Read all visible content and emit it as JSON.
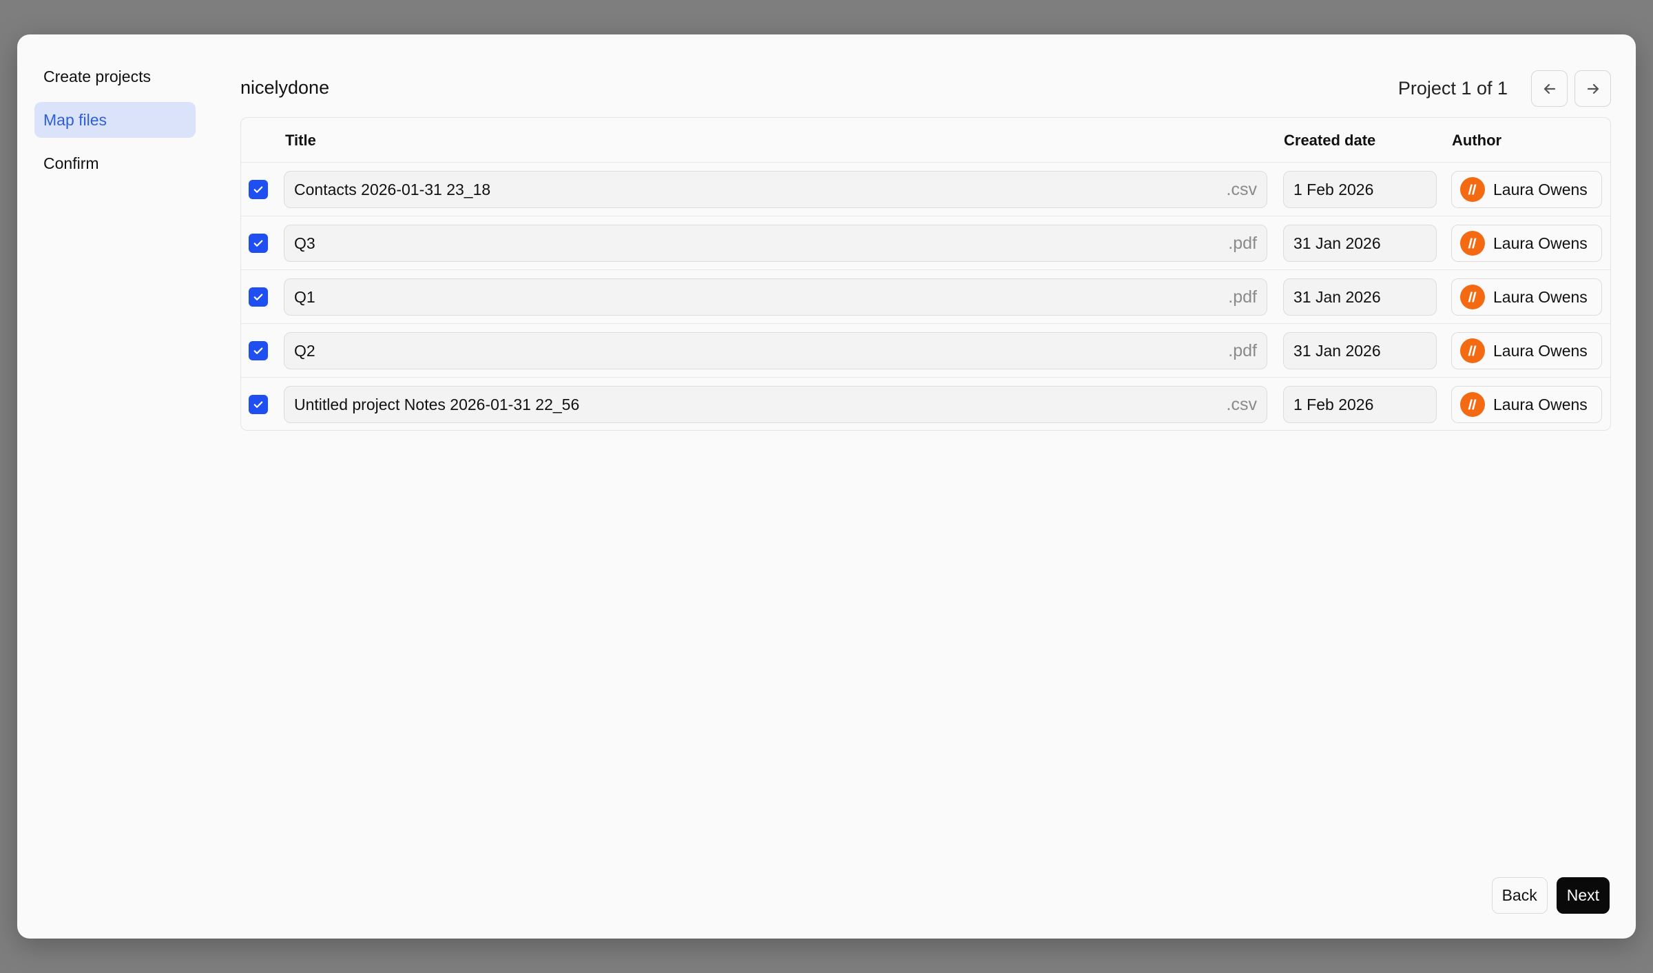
{
  "wizard": {
    "steps": [
      {
        "label": "Create projects"
      },
      {
        "label": "Map files"
      },
      {
        "label": "Confirm"
      }
    ],
    "active_step": 1
  },
  "header": {
    "project_name": "nicelydone",
    "pager_text": "Project 1 of 1",
    "prev_icon": "arrow-left-icon",
    "next_icon": "arrow-right-icon"
  },
  "table": {
    "columns": {
      "title": "Title",
      "created": "Created date",
      "author": "Author"
    },
    "rows": [
      {
        "checked": true,
        "title": "Contacts 2026-01-31 23_18",
        "ext": ".csv",
        "date": "1 Feb 2026",
        "author": "Laura Owens"
      },
      {
        "checked": true,
        "title": "Q3",
        "ext": ".pdf",
        "date": "31 Jan 2026",
        "author": "Laura Owens"
      },
      {
        "checked": true,
        "title": "Q1",
        "ext": ".pdf",
        "date": "31 Jan 2026",
        "author": "Laura Owens"
      },
      {
        "checked": true,
        "title": "Q2",
        "ext": ".pdf",
        "date": "31 Jan 2026",
        "author": "Laura Owens"
      },
      {
        "checked": true,
        "title": "Untitled project Notes 2026-01-31 22_56",
        "ext": ".csv",
        "date": "1 Feb 2026",
        "author": "Laura Owens"
      }
    ]
  },
  "footer": {
    "back_label": "Back",
    "next_label": "Next"
  },
  "colors": {
    "accent": "#1f4ff0",
    "active_step_bg": "#dbe3fb",
    "active_step_text": "#2f5fd6",
    "avatar": "#f36a12",
    "primary_button": "#0a0a0a"
  }
}
